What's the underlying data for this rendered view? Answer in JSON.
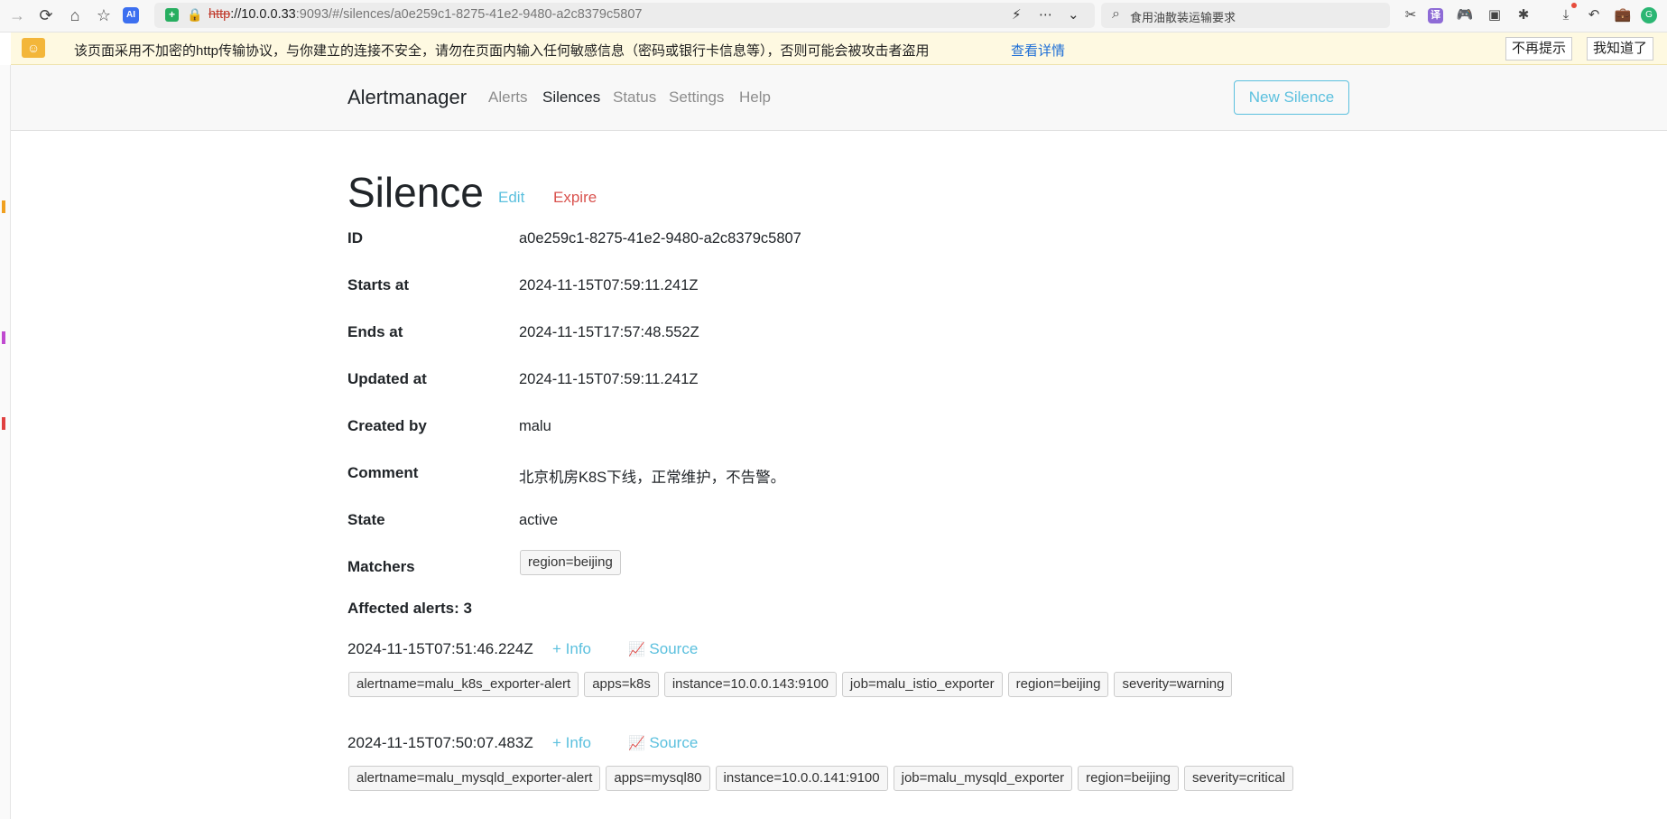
{
  "browser": {
    "url_protocol": "http",
    "url_host": "://10.0.0.33",
    "url_rest": ":9093/#/silences/a0e259c1-8275-41e2-9480-a2c8379c5807",
    "search_text": "食用油散装运输要求"
  },
  "warning": {
    "text": "该页面采用不加密的http传输协议，与你建立的连接不安全，请勿在页面内输入任何敏感信息（密码或银行卡信息等），否则可能会被攻击者盗用",
    "link": "查看详情",
    "btn_dismiss": "不再提示",
    "btn_ok": "我知道了"
  },
  "nav": {
    "brand": "Alertmanager",
    "links": [
      "Alerts",
      "Silences",
      "Status",
      "Settings",
      "Help"
    ],
    "new_silence": "New Silence"
  },
  "silence": {
    "title": "Silence",
    "edit": "Edit",
    "expire": "Expire",
    "fields": [
      {
        "label": "ID",
        "value": "a0e259c1-8275-41e2-9480-a2c8379c5807"
      },
      {
        "label": "Starts at",
        "value": "2024-11-15T07:59:11.241Z"
      },
      {
        "label": "Ends at",
        "value": "2024-11-15T17:57:48.552Z"
      },
      {
        "label": "Updated at",
        "value": "2024-11-15T07:59:11.241Z"
      },
      {
        "label": "Created by",
        "value": "malu"
      },
      {
        "label": "Comment",
        "value": "北京机房K8S下线，正常维护，不告警。"
      },
      {
        "label": "State",
        "value": "active"
      }
    ],
    "matchers_label": "Matchers",
    "matchers": [
      "region=beijing"
    ],
    "affected_label": "Affected alerts: 3",
    "info_label": "+ Info",
    "source_label": "Source",
    "alerts": [
      {
        "timestamp": "2024-11-15T07:51:46.224Z",
        "labels": [
          "alertname=malu_k8s_exporter-alert",
          "apps=k8s",
          "instance=10.0.0.143:9100",
          "job=malu_istio_exporter",
          "region=beijing",
          "severity=warning"
        ]
      },
      {
        "timestamp": "2024-11-15T07:50:07.483Z",
        "labels": [
          "alertname=malu_mysqld_exporter-alert",
          "apps=mysql80",
          "instance=10.0.0.141:9100",
          "job=malu_mysqld_exporter",
          "region=beijing",
          "severity=critical"
        ]
      }
    ]
  },
  "colors": {
    "accent": "#5bc0de",
    "danger": "#d9534f",
    "warn_bg": "#fef9e1",
    "link_blue": "#1f6fd6"
  }
}
